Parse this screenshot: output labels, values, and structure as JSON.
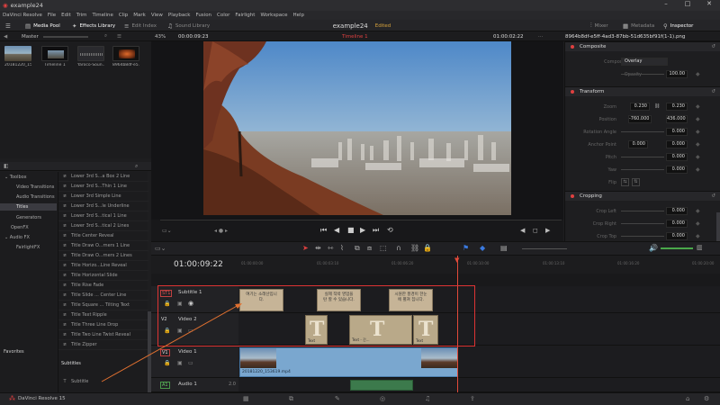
{
  "titlebar": {
    "app_title": "example24"
  },
  "menu": {
    "items": [
      "DaVinci Resolve",
      "File",
      "Edit",
      "Trim",
      "Timeline",
      "Clip",
      "Mark",
      "View",
      "Playback",
      "Fusion",
      "Color",
      "Fairlight",
      "Workspace",
      "Help"
    ]
  },
  "toolbar": {
    "media_pool": "Media Pool",
    "effects_library": "Effects Library",
    "edit_index": "Edit Index",
    "sound_library": "Sound Library",
    "project_name": "example24",
    "edited": "Edited",
    "mixer": "Mixer",
    "metadata": "Metadata",
    "inspector": "Inspector"
  },
  "subbar": {
    "bin": "Master",
    "zoom": "43%",
    "source_tc": "00:00:09:23",
    "timeline_name": "Timeline 1",
    "record_tc": "01:00:02:22",
    "clip_name": "8964b8df-e5ff-4ad3-87bb-51d635bf91f(1-1).png"
  },
  "media_pool": {
    "clips": [
      {
        "name": "20181220_15..."
      },
      {
        "name": "Timeline 1"
      },
      {
        "name": "Yaroco-Soun..."
      },
      {
        "name": "8964b8df-e5..."
      }
    ]
  },
  "effects": {
    "tree": [
      {
        "label": "Toolbox"
      },
      {
        "label": "Video Transitions"
      },
      {
        "label": "Audio Transitions"
      },
      {
        "label": "Titles"
      },
      {
        "label": "Generators"
      },
      {
        "label": "OpenFX"
      },
      {
        "label": "Audio FX"
      },
      {
        "label": "FairlightFX"
      }
    ],
    "favorites": "Favorites",
    "titles": [
      "Lower 3rd S...a Box 2 Line",
      "Lower 3rd S...Thin 1 Line",
      "Lower 3rd Simple Line",
      "Lower 3rd S...le Underline",
      "Lower 3rd S...tical 1 Line",
      "Lower 3rd S...tical 2 Lines",
      "Title Center Reveal",
      "Title Draw O...rners 1 Line",
      "Title Draw O...rners 2 Lines",
      "Title Horizo...Line Reveal",
      "Title Horizontal Slide",
      "Title Rise Fade",
      "Title Slide ... Center Line",
      "Title Square ... Tilting Text",
      "Title Text Ripple",
      "Title Three Line Drop",
      "Title Two Line Twist Reveal",
      "Title Zipper"
    ],
    "subtitles_header": "Subtitles",
    "subtitle_item": "Subtitle"
  },
  "inspector": {
    "composite": "Composite",
    "composite_mode_label": "Composite Mode",
    "composite_mode": "Overlay",
    "opacity_label": "Opacity",
    "opacity": "100.00",
    "transform": "Transform",
    "zoom_label": "Zoom",
    "zoom_x": "0.230",
    "zoom_y": "0.230",
    "position_label": "Position",
    "pos_x": "-760.000",
    "pos_y": "436.000",
    "rotation_label": "Rotation Angle",
    "rotation": "0.000",
    "anchor_label": "Anchor Point",
    "anchor_x": "0.000",
    "anchor_y": "0.000",
    "pitch_label": "Pitch",
    "pitch": "0.000",
    "yaw_label": "Yaw",
    "yaw": "0.000",
    "flip_label": "Flip",
    "cropping": "Cropping",
    "crop_left_label": "Crop Left",
    "crop_left": "0.000",
    "crop_right_label": "Crop Right",
    "crop_right": "0.000",
    "crop_top_label": "Crop Top",
    "crop_top": "0.000"
  },
  "timeline": {
    "timecode": "01:00:09:22",
    "ruler": [
      "01:00:00:00",
      "01:00:03:10",
      "01:00:06:20",
      "01:00:10:00",
      "01:00:13:10",
      "01:00:16:20",
      "01:00:20:00"
    ],
    "tracks": {
      "st1": {
        "tag": "ST1",
        "name": "Subtitle 1"
      },
      "v2": {
        "tag": "V2",
        "name": "Video 2"
      },
      "v1": {
        "tag": "V1",
        "name": "Video 1"
      },
      "a1": {
        "tag": "A1",
        "name": "Audio 1",
        "level": "2.0"
      }
    },
    "subtitles": [
      "여기는 소래산입니다.",
      "실제 직박 영업을 탄 할 수 있습니다.",
      "시원한 풍경이 한눈에 펼쳐 집니다."
    ],
    "title_clip_label": "Text",
    "title_clip_label2": "Text - 간...",
    "video_clip": "20181220_153619.mp4"
  },
  "bottom": {
    "app": "DaVinci Resolve 15"
  }
}
